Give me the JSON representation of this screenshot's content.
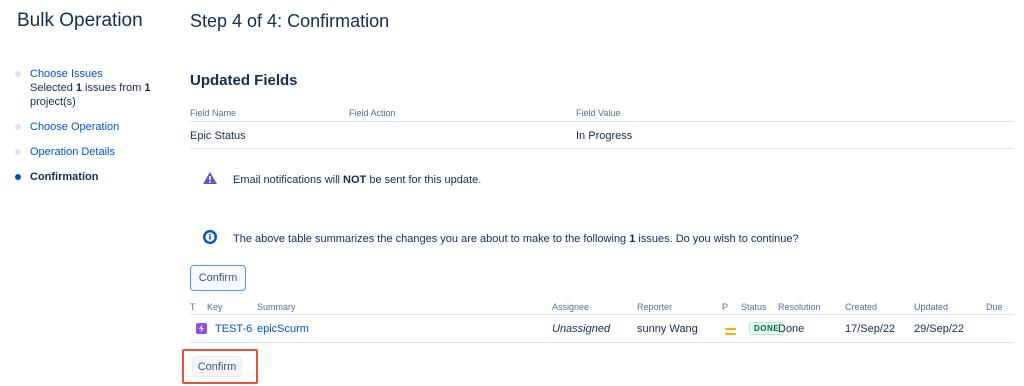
{
  "sidebar": {
    "title": "Bulk Operation",
    "steps": [
      {
        "label": "Choose Issues",
        "sub_prefix": "Selected ",
        "sub_count": "1",
        "sub_middle": " issues from ",
        "sub_projects": "1",
        "sub_suffix": " project(s)"
      },
      {
        "label": "Choose Operation"
      },
      {
        "label": "Operation Details"
      },
      {
        "label": "Confirmation"
      }
    ],
    "current_step_color": "#0052cc"
  },
  "main": {
    "title": "Step 4 of 4: Confirmation",
    "updated_fields_title": "Updated Fields",
    "fields_table": {
      "headers": [
        "Field Name",
        "Field Action",
        "Field Value"
      ],
      "rows": [
        {
          "name": "Epic Status",
          "action": "",
          "value": "In Progress"
        }
      ]
    },
    "warning": {
      "icon": "warning-icon",
      "prefix": "Email notifications will ",
      "bold": "NOT",
      "suffix": " be sent for this update."
    },
    "info": {
      "icon": "info-icon",
      "prefix": "The above table summarizes the changes you are about to make to the following ",
      "bold": "1",
      "suffix": " issues. Do you wish to continue?"
    },
    "confirm_top_label": "Confirm",
    "issues_table": {
      "headers": [
        "T",
        "Key",
        "Summary",
        "Assignee",
        "Reporter",
        "P",
        "Status",
        "Resolution",
        "Created",
        "Updated",
        "Due"
      ],
      "rows": [
        {
          "type_icon": "epic-icon",
          "key": "TEST-6",
          "summary": "epicScurm",
          "assignee": "Unassigned",
          "reporter": "sunny Wang",
          "priority_icon": "priority-medium-icon",
          "status": "DONE",
          "resolution": "Done",
          "created": "17/Sep/22",
          "updated": "29/Sep/22",
          "due": ""
        }
      ]
    },
    "confirm_bottom_label": "Confirm",
    "highlight_color": "#e5533b"
  }
}
